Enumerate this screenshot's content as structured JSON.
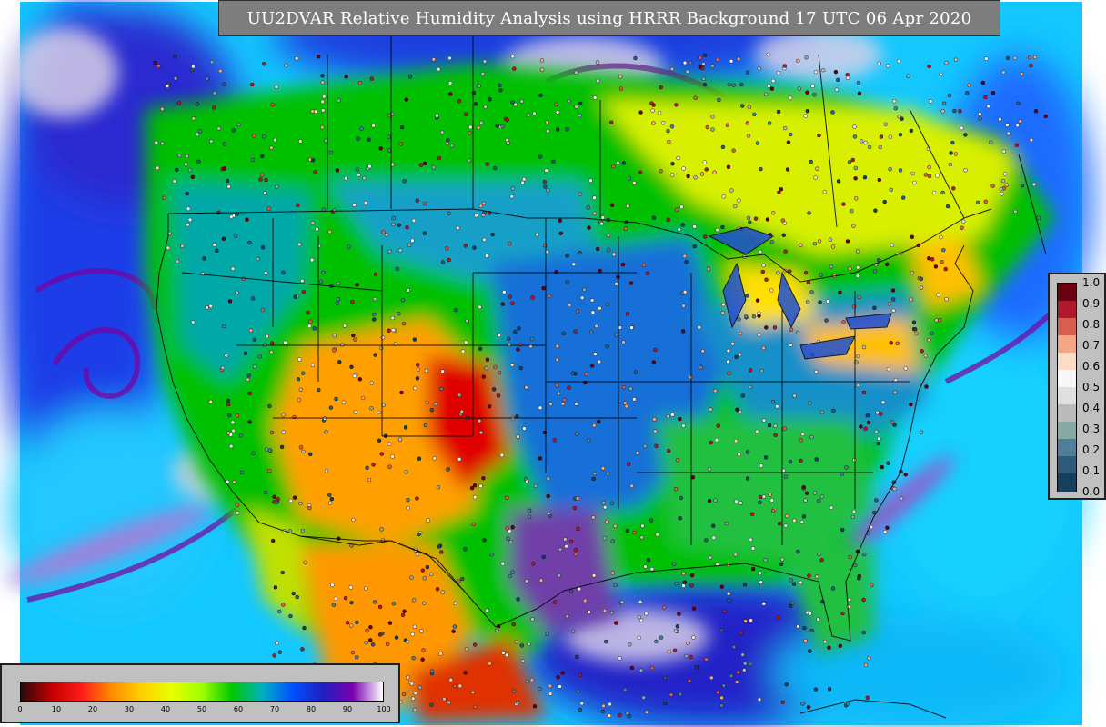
{
  "title": "UU2DVAR Relative Humidity Analysis using HRRR Background 17 UTC 06 Apr 2020",
  "rh_colorbar": {
    "ticks": [
      "0",
      "10",
      "20",
      "30",
      "40",
      "50",
      "60",
      "70",
      "80",
      "90",
      "100"
    ],
    "colors": [
      "#2a0a0a",
      "#c00000",
      "#ff1a1a",
      "#ff8c00",
      "#ffd000",
      "#e8ff00",
      "#a0ff00",
      "#00c800",
      "#00b0c0",
      "#0050ff",
      "#2020c0",
      "#7a00b0",
      "#ffffff"
    ]
  },
  "obs_colorbar": {
    "ticks": [
      "1.0",
      "0.9",
      "0.8",
      "0.7",
      "0.6",
      "0.5",
      "0.4",
      "0.3",
      "0.2",
      "0.1",
      "0.0"
    ],
    "colors": [
      "#6b0010",
      "#b2182b",
      "#d6604d",
      "#f4a582",
      "#fddbc7",
      "#f7f7f7",
      "#e0e0e0",
      "#bababa",
      "#87a9a4",
      "#4f7f99",
      "#2b5a7a",
      "#14405e"
    ]
  },
  "map_colors": {
    "ocean_dry": "#00d7ff",
    "ocean_moist": "#2030d8",
    "saturated": "#d8d0e8",
    "purple": "#7a00a0",
    "land_moist": "#00c000",
    "land_mid": "#00a8c8",
    "land_dry": "#ff9000",
    "land_vdry": "#e00000",
    "canada_yellow": "#e8f000",
    "border": "#000000"
  }
}
